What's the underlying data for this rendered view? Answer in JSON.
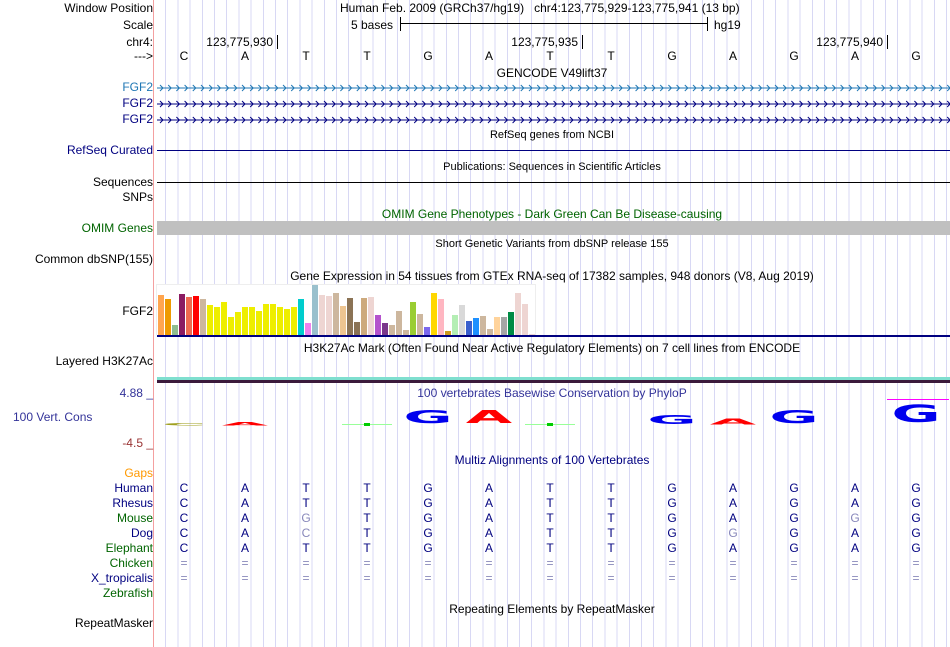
{
  "header": {
    "window_position_label": "Window Position",
    "position_text": "Human Feb. 2009 (GRCh37/hg19)   chr4:123,775,929-123,775,941 (13 bp)",
    "scale_label": "Scale",
    "scale_text": "5 bases",
    "assembly": "hg19",
    "chrom_label": "chr4:",
    "strand_label": "--->",
    "ticks": [
      "123,775,930",
      "123,775,935",
      "123,775,940"
    ]
  },
  "sequence": [
    "C",
    "A",
    "T",
    "T",
    "G",
    "A",
    "T",
    "T",
    "G",
    "A",
    "G",
    "A",
    "G"
  ],
  "tracks": {
    "gencode_title": "GENCODE V49lift37",
    "gencode_genes": [
      "FGF2",
      "FGF2",
      "FGF2"
    ],
    "refseq_title": "RefSeq genes from NCBI",
    "refseq_label": "RefSeq Curated",
    "pubs_title": "Publications: Sequences in Scientific Articles",
    "pubs_label": "Sequences",
    "snps_label": "SNPs",
    "omim_title": "OMIM Gene Phenotypes - Dark Green Can Be Disease-causing",
    "omim_label": "OMIM Genes",
    "dbsnp_title": "Short Genetic Variants from dbSNP release 155",
    "dbsnp_label": "Common dbSNP(155)",
    "gtex_title": "Gene Expression in 54 tissues from GTEx RNA-seq of 17382 samples, 948 donors (V8, Aug 2019)",
    "gtex_label": "FGF2",
    "h3k_title": "H3K27Ac Mark (Often Found Near Active Regulatory Elements) on 7 cell lines from ENCODE",
    "h3k_label": "Layered H3K27Ac",
    "cons_title": "100 vertebrates Basewise Conservation by PhyloP",
    "cons_label": "100 Vert. Cons",
    "cons_max": "4.88 _",
    "cons_min": "-4.5 _",
    "multiz_title": "Multiz Alignments of 100 Vertebrates",
    "gaps_label": "Gaps",
    "rmsk_title": "Repeating Elements by RepeatMasker",
    "rmsk_label": "RepeatMasker"
  },
  "gtex": {
    "values": [
      0.81,
      0.73,
      0.21,
      0.83,
      0.77,
      0.78,
      0.73,
      0.61,
      0.57,
      0.67,
      0.37,
      0.47,
      0.57,
      0.56,
      0.48,
      0.62,
      0.63,
      0.57,
      0.53,
      0.57,
      0.73,
      0.25,
      1.0,
      0.81,
      0.78,
      0.85,
      0.59,
      0.75,
      0.27,
      0.74,
      0.77,
      0.41,
      0.25,
      0.2,
      0.49,
      0.11,
      0.67,
      0.43,
      0.17,
      0.85,
      0.73,
      0.08,
      0.41,
      0.61,
      0.29,
      0.35,
      0.39,
      0.13,
      0.36,
      0.37,
      0.47,
      0.85,
      0.62,
      0.02
    ],
    "colors": [
      "#FFA54F",
      "#EE9A00",
      "#8FBC8F",
      "#8B1C62",
      "#EE6A50",
      "#FF0000",
      "#CDB79E",
      "#EEEE00",
      "#EEEE00",
      "#EEEE00",
      "#EEEE00",
      "#EEEE00",
      "#EEEE00",
      "#EEEE00",
      "#EEEE00",
      "#EEEE00",
      "#EEEE00",
      "#EEEE00",
      "#EEEE00",
      "#EEEE00",
      "#00CDCD",
      "#EE82EE",
      "#9AC0CD",
      "#EED5D2",
      "#EED5D2",
      "#CDB79E",
      "#EEC591",
      "#8B7355",
      "#8B7355",
      "#CDAA7D",
      "#EED5D2",
      "#B452CD",
      "#7A378B",
      "#CDB79E",
      "#CDB79E",
      "#CDB79E",
      "#9ACD32",
      "#CDB79E",
      "#7B68EE",
      "#FFD700",
      "#FFB6C1",
      "#CD9B1D",
      "#B4EEB4",
      "#D9D9D9",
      "#3A5FCD",
      "#1E90FF",
      "#CDB79E",
      "#CDB79E",
      "#FFD39B",
      "#A6A6A6",
      "#008B45",
      "#EED5D2",
      "#EED5D2",
      "#EED5D2"
    ]
  },
  "conservation": [
    {
      "b": "C",
      "s": 0.08,
      "c": "#a0a020"
    },
    {
      "b": "A",
      "s": 0.1,
      "c": "#ff0000"
    },
    {
      "b": "",
      "s": 0,
      "c": "#000"
    },
    {
      "b": "-",
      "s": 0.03,
      "c": "#00cc00"
    },
    {
      "b": "G",
      "s": 0.45,
      "c": "#0000ee"
    },
    {
      "b": "A",
      "s": 0.45,
      "c": "#ff0000"
    },
    {
      "b": "-",
      "s": 0.03,
      "c": "#00cc00"
    },
    {
      "b": "",
      "s": 0,
      "c": "#000"
    },
    {
      "b": "G",
      "s": 0.3,
      "c": "#0000ee"
    },
    {
      "b": "A",
      "s": 0.2,
      "c": "#ff0000"
    },
    {
      "b": "G",
      "s": 0.45,
      "c": "#0000ee"
    },
    {
      "b": "",
      "s": 0,
      "c": "#000"
    },
    {
      "b": "G",
      "s": 0.6,
      "c": "#0000ee"
    }
  ],
  "multiz": [
    {
      "species": "Human",
      "color": "#000080",
      "bases": "CATTGATTGAGAG"
    },
    {
      "species": "Rhesus",
      "color": "#000080",
      "bases": "CATTGATTGAGAG"
    },
    {
      "species": "Mouse",
      "color": "#006400",
      "bases": "CAGTGATTGAGGG",
      "mismatch": [
        2,
        11
      ]
    },
    {
      "species": "Dog",
      "color": "#000080",
      "bases": "CACTGATTGGGAG",
      "mismatch": [
        2,
        9
      ]
    },
    {
      "species": "Elephant",
      "color": "#006400",
      "bases": "CATTGATTGAGAG"
    },
    {
      "species": "Chicken",
      "color": "#006400",
      "bases": "============="
    },
    {
      "species": "X_tropicalis",
      "color": "#000080",
      "bases": "============="
    },
    {
      "species": "Zebrafish",
      "color": "#006400",
      "bases": ""
    }
  ],
  "colors": {
    "gencode_first": "#1f77b4",
    "navy": "#000080",
    "omim_band": "#c0c0c0",
    "h3k_teal": "#7fdfcf",
    "h3k_dark": "#3b1a3b"
  }
}
